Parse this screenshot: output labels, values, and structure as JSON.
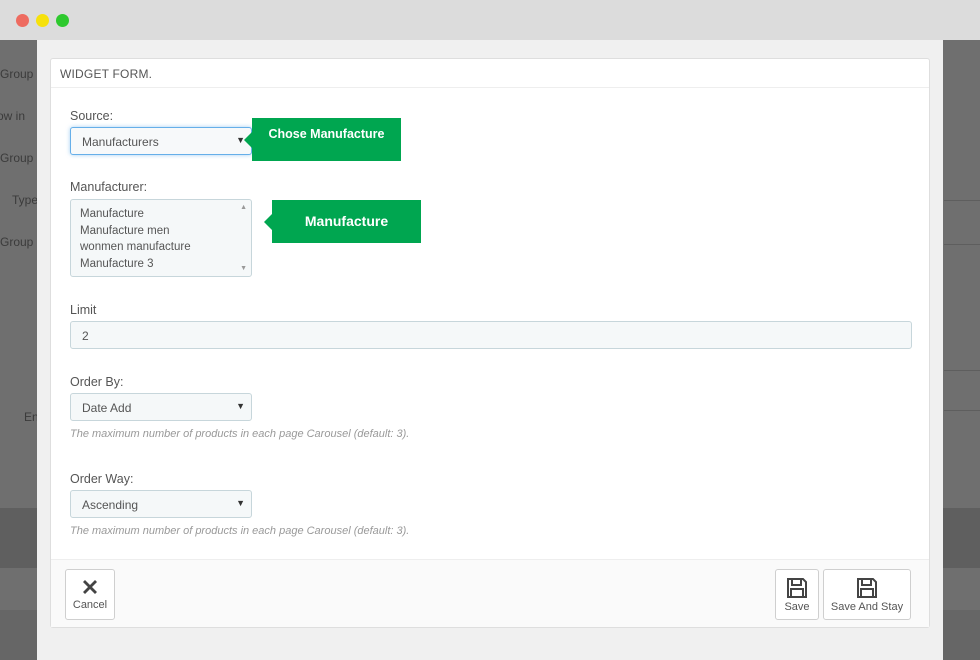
{
  "window": {
    "controls": [
      "close",
      "minimize",
      "maximize"
    ]
  },
  "background_labels": [
    "Group",
    "ow in",
    "Group",
    "Type",
    "Group",
    "En"
  ],
  "panel": {
    "heading": "WIDGET FORM."
  },
  "form": {
    "source": {
      "label": "Source:",
      "value": "Manufacturers"
    },
    "manufacturer": {
      "label": "Manufacturer:",
      "options": [
        "Manufacture",
        "Manufacture men",
        "wonmen manufacture",
        "Manufacture 3"
      ]
    },
    "limit": {
      "label": "Limit",
      "value": "2"
    },
    "order_by": {
      "label": "Order By:",
      "value": "Date Add",
      "help": "The maximum number of products in each page Carousel (default: 3)."
    },
    "order_way": {
      "label": "Order Way:",
      "value": "Ascending",
      "help": "The maximum number of products in each page Carousel (default: 3)."
    }
  },
  "callouts": {
    "source": "Chose Manufacture",
    "manufacturer": "Manufacture"
  },
  "footer": {
    "cancel": "Cancel",
    "save": "Save",
    "save_and_stay": "Save And Stay"
  },
  "colors": {
    "callout": "#00a650",
    "focus_border": "#66afe9"
  }
}
